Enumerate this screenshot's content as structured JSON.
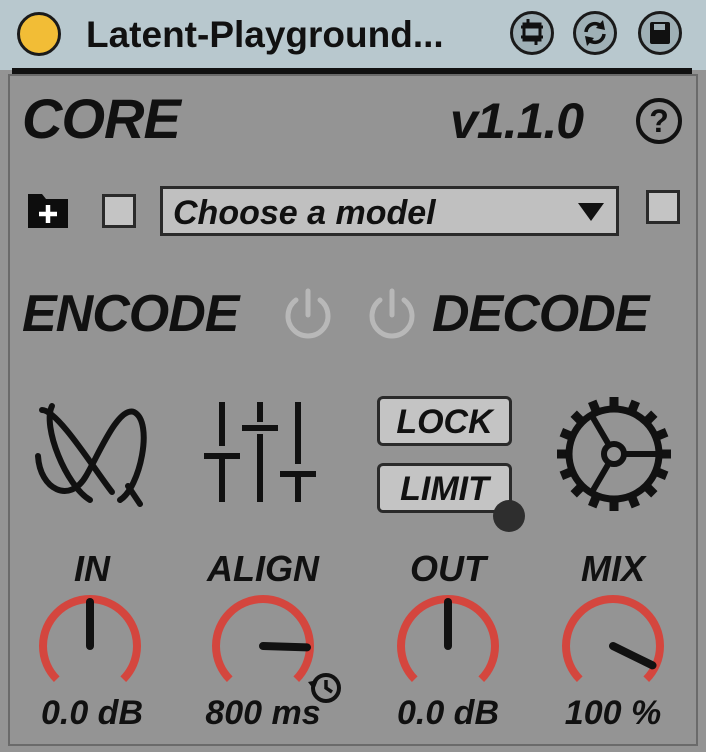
{
  "window": {
    "title": "Latent-Playground...",
    "traffic_light_color": "#f2bd36",
    "buttons": [
      {
        "name": "freeze-button",
        "icon": "freeze-icon"
      },
      {
        "name": "refresh-button",
        "icon": "refresh-icon"
      },
      {
        "name": "save-button",
        "icon": "save-icon"
      }
    ]
  },
  "header": {
    "title": "CORE",
    "version": "v1.1.0",
    "help_label": "?"
  },
  "model": {
    "folder_icon": "folder-plus-icon",
    "dropdown_label": "Choose a model"
  },
  "engine": {
    "encode_label": "ENCODE",
    "decode_label": "DECODE",
    "encode_power_icon": "power-icon",
    "decode_power_icon": "power-icon"
  },
  "tools": {
    "latent_icon": "latent-space-icon",
    "mixer_icon": "sliders-icon",
    "lock_label": "LOCK",
    "limit_label": "LIMIT",
    "settings_icon": "gear-icon"
  },
  "dials": [
    {
      "label": "IN",
      "value": "0.0 dB",
      "level": 0.5
    },
    {
      "label": "ALIGN",
      "value": "800 ms",
      "level": 0.84
    },
    {
      "label": "OUT",
      "value": "0.0 dB",
      "level": 0.5
    },
    {
      "label": "MIX",
      "value": "100 %",
      "level": 0.93
    }
  ],
  "colors": {
    "dial_arc": "#d4463e",
    "dial_track": "#222222",
    "panel": "#949494"
  }
}
